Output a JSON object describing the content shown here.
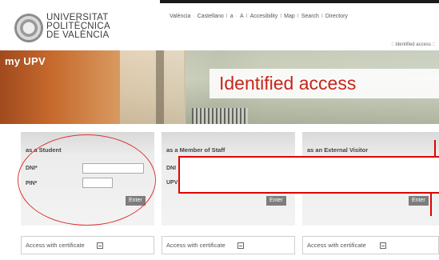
{
  "header": {
    "university": [
      "UNIVERSITAT",
      "POLITÈCNICA",
      "DE VALÈNCIA"
    ],
    "nav": [
      "València",
      "Castellano",
      "a",
      "A",
      "Accesibility",
      "Map",
      "Search",
      "Directory"
    ],
    "breadcrumb": "Identified access"
  },
  "banner": {
    "section": "my UPV",
    "title": "Identified access"
  },
  "panels": {
    "student": {
      "heading": "as a Student",
      "dni_label": "DNI*",
      "pin_label": "PIN*",
      "dni_value": "",
      "pin_value": "",
      "enter": "Enter"
    },
    "staff": {
      "heading": "as a Member of Staff",
      "dni_label": "DNI",
      "upv_label": "UPV",
      "enter": "Enter"
    },
    "external": {
      "heading": "as an External Visitor",
      "enter": "Enter"
    }
  },
  "certificate": {
    "label": "Access with certificate"
  },
  "icons": {
    "logo": "university-seal-icon",
    "certificate": "certificate-window-icon"
  },
  "colors": {
    "title_red": "#c8261a",
    "annotation_red": "#e00000",
    "button_gray": "#7d7d7d"
  }
}
